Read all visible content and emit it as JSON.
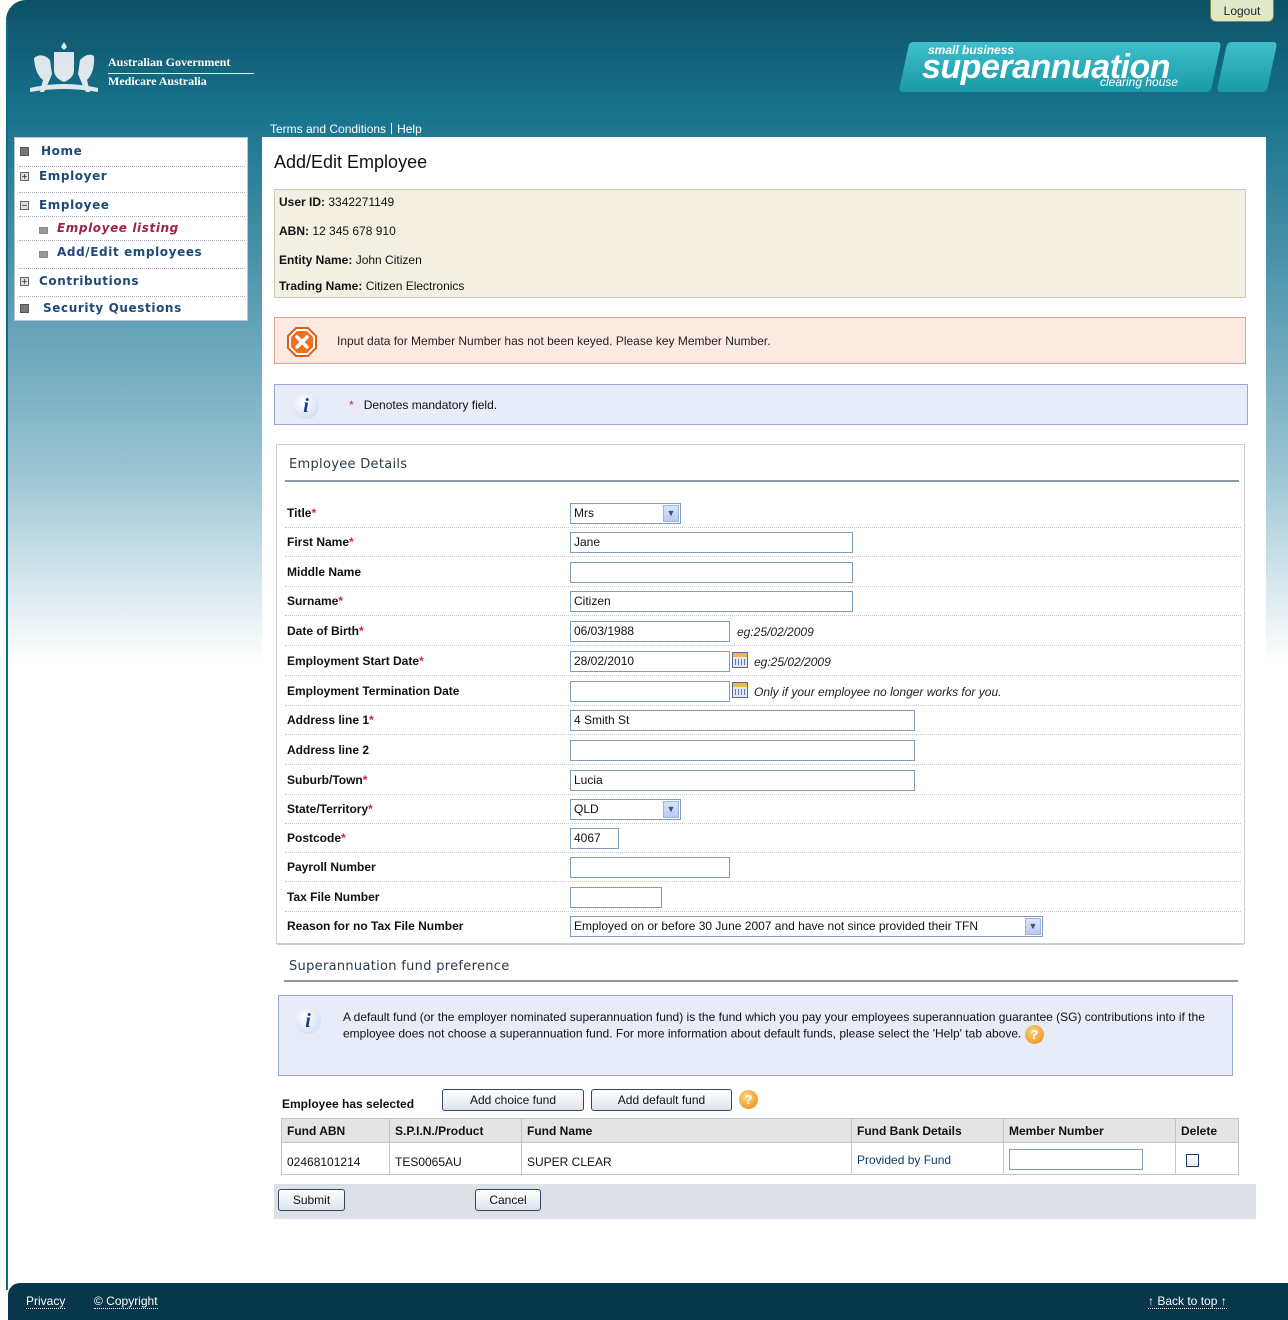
{
  "header": {
    "gov_line1": "Australian Government",
    "gov_line2": "Medicare Australia",
    "logout": "Logout",
    "logo_small": "small business",
    "logo_main": "superannuation",
    "logo_sub": "clearing house",
    "links": [
      "Terms and Conditions",
      "Help"
    ]
  },
  "sidebar": {
    "items": [
      {
        "label": "Home",
        "icon": "square-icon"
      },
      {
        "label": "Employer",
        "icon": "plus-box-icon"
      },
      {
        "label": "Employee",
        "icon": "minus-box-icon"
      },
      {
        "label": "Employee listing",
        "icon": "bullet-icon",
        "active": true
      },
      {
        "label": "Add/Edit employees",
        "icon": "bullet-icon"
      },
      {
        "label": "Contributions",
        "icon": "plus-box-icon"
      },
      {
        "label": "Security Questions",
        "icon": "square-icon"
      }
    ]
  },
  "page": {
    "title": "Add/Edit Employee",
    "user_id_label": "User ID:",
    "user_id": "3342271149",
    "abn_label": "ABN:",
    "abn": "12 345 678 910",
    "entity_label": "Entity Name:",
    "entity": "John Citizen",
    "trading_label": "Trading Name:",
    "trading": "Citizen Electronics",
    "error": "Input data for Member Number has not been keyed. Please key Member Number.",
    "mandatory_star": "*",
    "mandatory_note": "Denotes mandatory field."
  },
  "employee": {
    "section_title": "Employee Details",
    "title_label": "Title",
    "title_value": "Mrs",
    "first_name_label": "First Name",
    "first_name": "Jane",
    "middle_name_label": "Middle Name",
    "middle_name": "",
    "surname_label": "Surname",
    "surname": "Citizen",
    "dob_label": "Date of Birth",
    "dob": "06/03/1988",
    "dob_hint": "eg:25/02/2009",
    "start_label": "Employment Start Date",
    "start": "28/02/2010",
    "start_hint": "eg:25/02/2009",
    "term_label": "Employment Termination Date",
    "term": "",
    "term_hint": "Only if your employee no longer works for you.",
    "addr1_label": "Address line 1",
    "addr1": "4 Smith St",
    "addr2_label": "Address line 2",
    "addr2": "",
    "suburb_label": "Suburb/Town",
    "suburb": "Lucia",
    "state_label": "State/Territory",
    "state": "QLD",
    "postcode_label": "Postcode",
    "postcode": "4067",
    "payroll_label": "Payroll Number",
    "payroll": "",
    "tfn_label": "Tax File Number",
    "tfn": "",
    "no_tfn_label": "Reason for no Tax File Number",
    "no_tfn": "Employed on or before 30 June 2007 and have not since provided their TFN"
  },
  "fund": {
    "section_title": "Superannuation fund preference",
    "note": "A default fund (or the employer nominated superannuation fund) is the fund which you pay your employees superannuation guarantee (SG) contributions into if the employee does not choose a superannuation fund. For more information about default funds, please select the 'Help' tab above.",
    "selected_label": "Employee has selected",
    "add_choice": "Add choice fund",
    "add_default": "Add default fund",
    "columns": [
      "Fund ABN",
      "S.P.I.N./Product",
      "Fund Name",
      "Fund Bank Details",
      "Member Number",
      "Delete"
    ],
    "row": {
      "abn": "02468101214",
      "spin": "TES0065AU",
      "name": "SUPER CLEAR",
      "bank": "Provided by Fund",
      "member": ""
    }
  },
  "actions": {
    "submit": "Submit",
    "cancel": "Cancel"
  },
  "footer": {
    "privacy": "Privacy",
    "copyright": "© Copyright",
    "back_to_top": "↑ Back to top ↑"
  }
}
